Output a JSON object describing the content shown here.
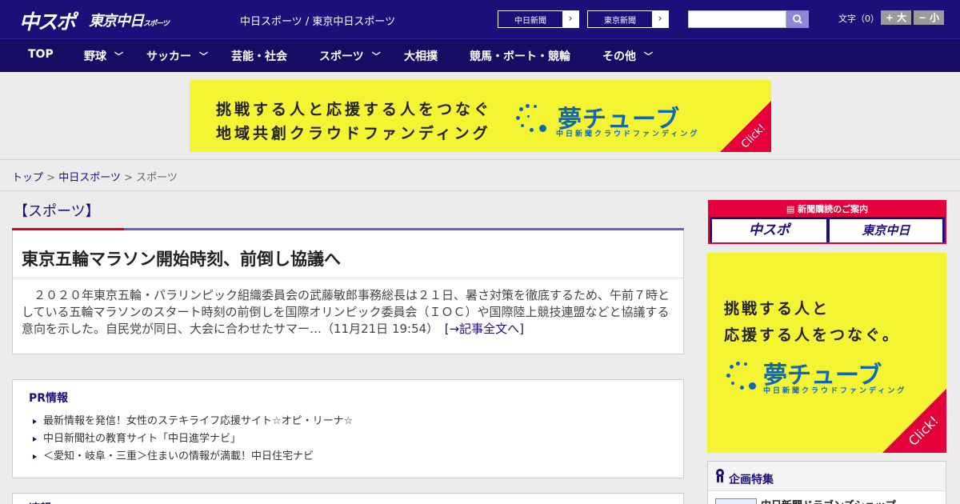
{
  "header": {
    "logo_chunichi_sports": "中スポ",
    "logo_tokyo_chunichi": "東京中日",
    "logo_tokyo_chunichi_suffix": "スポーツ",
    "site_title": "中日スポーツ / 東京中日スポーツ",
    "link_chunichi_shimbun": "中日新聞",
    "link_tokyo_shimbun": "東京新聞",
    "arrow": "›",
    "search_placeholder": "",
    "text_size_label": "文字（0）",
    "text_larger": "+ 大",
    "text_smaller": "− 小"
  },
  "nav": {
    "items": [
      {
        "label": "TOP",
        "dropdown": false
      },
      {
        "label": "野球",
        "dropdown": true
      },
      {
        "label": "サッカー",
        "dropdown": true
      },
      {
        "label": "芸能・社会",
        "dropdown": false
      },
      {
        "label": "スポーツ",
        "dropdown": true
      },
      {
        "label": "大相撲",
        "dropdown": false
      },
      {
        "label": "競馬・ボート・競輪",
        "dropdown": false
      },
      {
        "label": "その他",
        "dropdown": true
      }
    ],
    "chevron": "﹀"
  },
  "banner": {
    "line1": "挑戦する人と応援する人をつなぐ",
    "line2": "地域共創クラウドファンディング",
    "brand": "夢チューブ",
    "brand_sub": "中日新聞クラウドファンディング",
    "click": "Click!"
  },
  "breadcrumb": {
    "home": "トップ",
    "sep": " > ",
    "parent": "中日スポーツ",
    "current": "スポーツ"
  },
  "section": {
    "title": "【スポーツ】"
  },
  "article": {
    "headline": "東京五輪マラソン開始時刻、前倒し協議へ",
    "body": "２０２０年東京五輪・パラリンピック組織委員会の武藤敏郎事務総長は２１日、暑さ対策を徹底するため、午前７時としている五輪マラソンのスタート時刻の前倒しを国際オリンピック委員会（ＩＯＣ）や国際陸上競技連盟などと協議する意向を示した。自民党が同日、大会に合わせたサマー…（11月21日 19:54）",
    "more": "[→記事全文へ]"
  },
  "pr": {
    "title": "PR情報",
    "items": [
      "最新情報を発信！女性のステキライフ応援サイト☆オピ・リーナ☆",
      "中日新聞社の教育サイト「中日進学ナビ」",
      "＜愛知・岐阜・三重＞住まいの情報が満載！中日住宅ナビ"
    ]
  },
  "next_box": {
    "title": "速報"
  },
  "sidebar": {
    "subscribe_header": "新聞購読のご案内",
    "subscribe_btn1": "中スポ",
    "subscribe_btn2": "東京中日",
    "ad_line1": "挑戦する人と",
    "ad_line2": "応援する人をつなぐ。",
    "ad_brand": "夢チューブ",
    "ad_brand_sub": "中日新聞クラウドファンディング",
    "ad_click": "Click!",
    "feature_title": "企画特集",
    "feature_item": "中日新聞ドラゴンズショップ"
  },
  "colors": {
    "navy": "#1b0f7a",
    "red": "#d7002c",
    "yellow": "#f4f432",
    "blue": "#0d69b3"
  }
}
